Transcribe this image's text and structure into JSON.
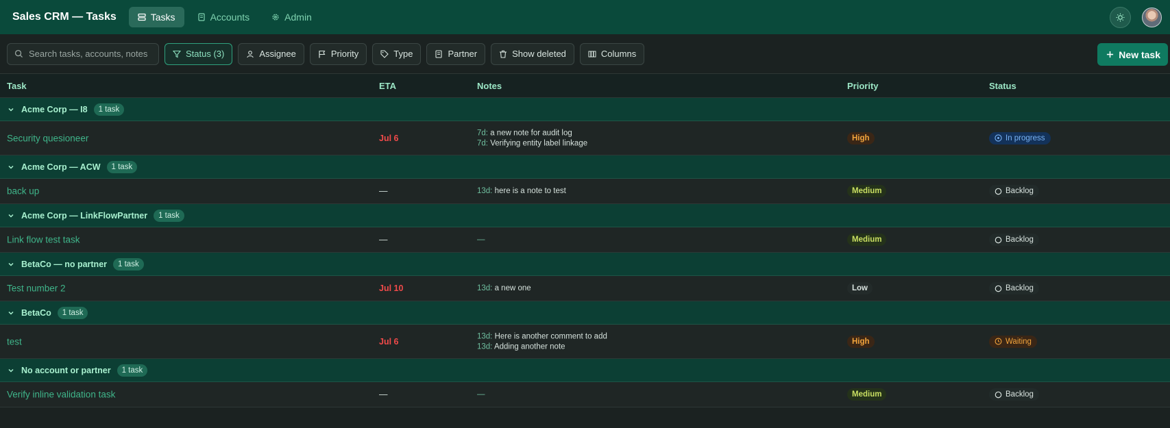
{
  "app": {
    "title": "Sales CRM — Tasks"
  },
  "nav": [
    {
      "label": "Tasks",
      "icon": "tasks-icon",
      "active": true
    },
    {
      "label": "Accounts",
      "icon": "accounts-icon",
      "active": false
    },
    {
      "label": "Admin",
      "icon": "gear-icon",
      "active": false
    }
  ],
  "toolbar": {
    "search_placeholder": "Search tasks, accounts, notes",
    "status_filter": "Status (3)",
    "assignee": "Assignee",
    "priority": "Priority",
    "type": "Type",
    "partner": "Partner",
    "show_deleted": "Show deleted",
    "columns": "Columns",
    "new_task": "New task"
  },
  "columns": {
    "task": "Task",
    "eta": "ETA",
    "notes": "Notes",
    "priority": "Priority",
    "status": "Status"
  },
  "groups": [
    {
      "title": "Acme Corp — I8",
      "count": "1 task",
      "task": {
        "name": "Security quesioneer",
        "eta": "Jul 6",
        "notes": [
          {
            "age": "7d:",
            "text": "a new note for audit log"
          },
          {
            "age": "7d:",
            "text": "Verifying entity label linkage"
          }
        ],
        "priority": "High",
        "status": "In progress"
      }
    },
    {
      "title": "Acme Corp — ACW",
      "count": "1 task",
      "task": {
        "name": "back up",
        "eta": "—",
        "notes": [
          {
            "age": "13d:",
            "text": "here is a note to test"
          }
        ],
        "priority": "Medium",
        "status": "Backlog"
      }
    },
    {
      "title": "Acme Corp — LinkFlowPartner",
      "count": "1 task",
      "task": {
        "name": "Link flow test task",
        "eta": "—",
        "notes_empty": "—",
        "priority": "Medium",
        "status": "Backlog"
      }
    },
    {
      "title": "BetaCo — no partner",
      "count": "1 task",
      "task": {
        "name": "Test number 2",
        "eta": "Jul 10",
        "notes": [
          {
            "age": "13d:",
            "text": "a new one"
          }
        ],
        "priority": "Low",
        "status": "Backlog"
      }
    },
    {
      "title": "BetaCo",
      "count": "1 task",
      "task": {
        "name": "test",
        "eta": "Jul 6",
        "notes": [
          {
            "age": "13d:",
            "text": "Here is another comment to add"
          },
          {
            "age": "13d:",
            "text": "Adding another note"
          }
        ],
        "priority": "High",
        "status": "Waiting"
      }
    },
    {
      "title": "No account or partner",
      "count": "1 task",
      "task": {
        "name": "Verify inline validation task",
        "eta": "—",
        "notes_empty": "—",
        "priority": "Medium",
        "status": "Backlog"
      }
    }
  ],
  "colors": {
    "header_bg": "#0a4a3b",
    "accent": "#0f7a60",
    "overdue": "#f04a4a"
  }
}
